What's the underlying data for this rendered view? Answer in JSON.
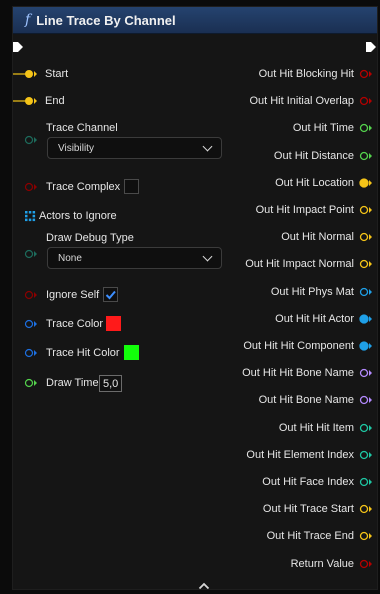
{
  "header": {
    "fx_glyph": "f",
    "title": "Line Trace By Channel"
  },
  "inputs": {
    "start": "Start",
    "end": "End",
    "trace_channel": {
      "label": "Trace Channel",
      "value": "Visibility"
    },
    "trace_complex": "Trace Complex",
    "actors_to_ignore": "Actors to Ignore",
    "draw_debug_type": {
      "label": "Draw Debug Type",
      "value": "None"
    },
    "ignore_self": "Ignore Self",
    "trace_color": "Trace Color",
    "trace_hit_color": "Trace Hit Color",
    "draw_time": {
      "label": "Draw Time",
      "value": "5,0"
    }
  },
  "outputs": [
    "Out Hit Blocking Hit",
    "Out Hit Initial Overlap",
    "Out Hit Time",
    "Out Hit Distance",
    "Out Hit Location",
    "Out Hit Impact Point",
    "Out Hit Normal",
    "Out Hit Impact Normal",
    "Out Hit Phys Mat",
    "Out Hit Hit Actor",
    "Out Hit Hit Component",
    "Out Hit Hit Bone Name",
    "Out Hit Bone Name",
    "Out Hit Hit Item",
    "Out Hit Element Index",
    "Out Hit Face Index",
    "Out Hit Trace Start",
    "Out Hit Trace End",
    "Return Value"
  ],
  "colors": {
    "bool": "#b40000",
    "float": "#54d34d",
    "vector": "#f5c418",
    "object": "#1fa0e8",
    "name": "#b48aff",
    "int": "#1ec7a3",
    "linear_color": "#1d6fe0",
    "struct": "#2f7fd6",
    "trace_color_swatch": "#ff1a1a",
    "trace_hit_color_swatch": "#12ff0a",
    "checkbox_check": "#3d8fff"
  },
  "icons": {
    "exec_in": "exec-arrow-icon",
    "exec_out": "exec-arrow-icon",
    "array": "array-grid-icon",
    "collapse": "chevron-up-icon"
  }
}
